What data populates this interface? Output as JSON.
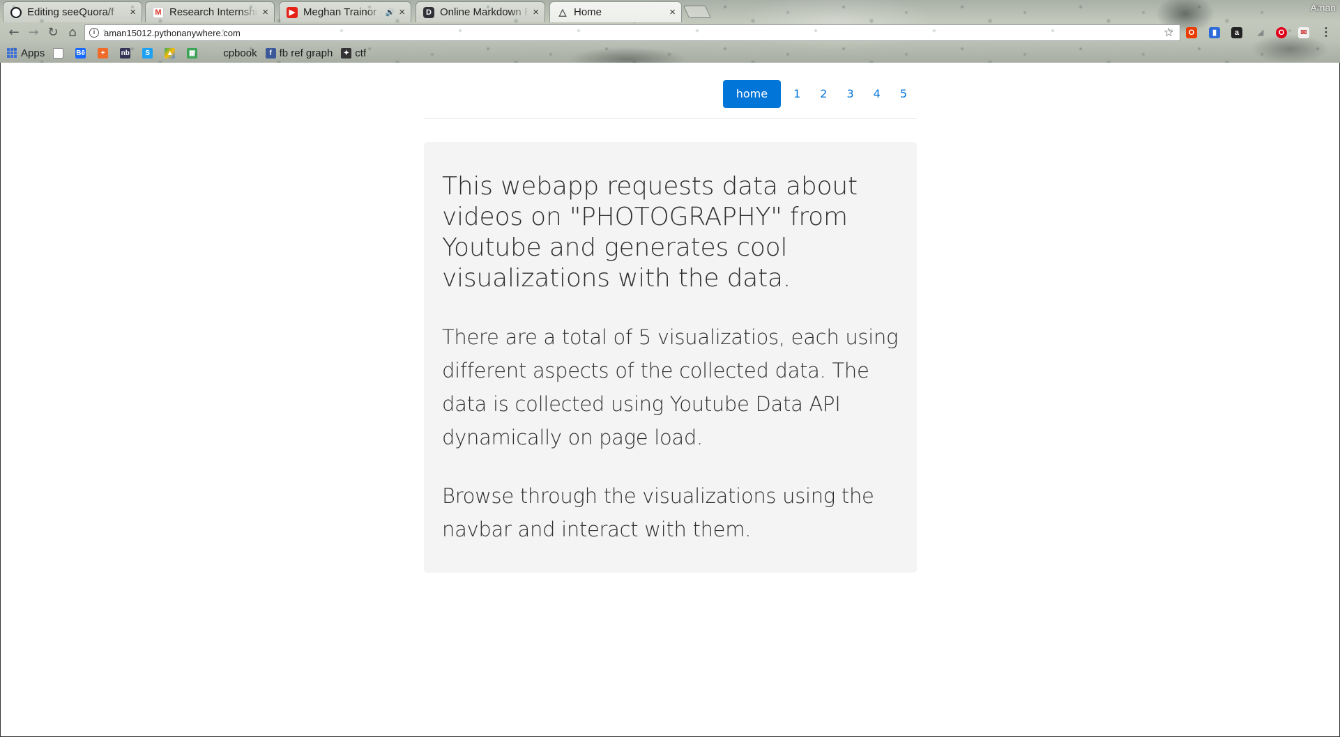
{
  "browser": {
    "tabs": [
      {
        "title": "Editing seeQuora/f",
        "icon": "github-icon",
        "close": "×"
      },
      {
        "title": "Research Internshi",
        "icon": "gmail-icon",
        "close": "×"
      },
      {
        "title": "Meghan Trainor -",
        "icon": "youtube-icon",
        "close": "×",
        "audio": "🔊"
      },
      {
        "title": "Online Markdown E",
        "icon": "dillinger-icon",
        "close": "×"
      },
      {
        "title": "Home",
        "icon": "triangle-icon",
        "close": "×"
      }
    ],
    "profile": "Aman",
    "url": "aman15012.pythonanywhere.com",
    "bookmarks": {
      "apps": "Apps",
      "cpbook": "cpbook",
      "fb_ref_graph": "fb ref graph",
      "ctf": "ctf"
    }
  },
  "nav": {
    "items": [
      "home",
      "1",
      "2",
      "3",
      "4",
      "5"
    ],
    "active": "home"
  },
  "jumbotron": {
    "heading": "This webapp requests data about videos on \"PHOTOGRAPHY\" from Youtube and generates cool visualizations with the data.",
    "para1": "There are a total of 5 visualizatios, each using different aspects of the collected data. The data is collected using Youtube Data API dynamically on page load.",
    "para2": "Browse through the visualizations using the navbar and interact with them."
  },
  "colors": {
    "primary": "#0275d8",
    "jumbotron_bg": "#f4f4f4"
  }
}
